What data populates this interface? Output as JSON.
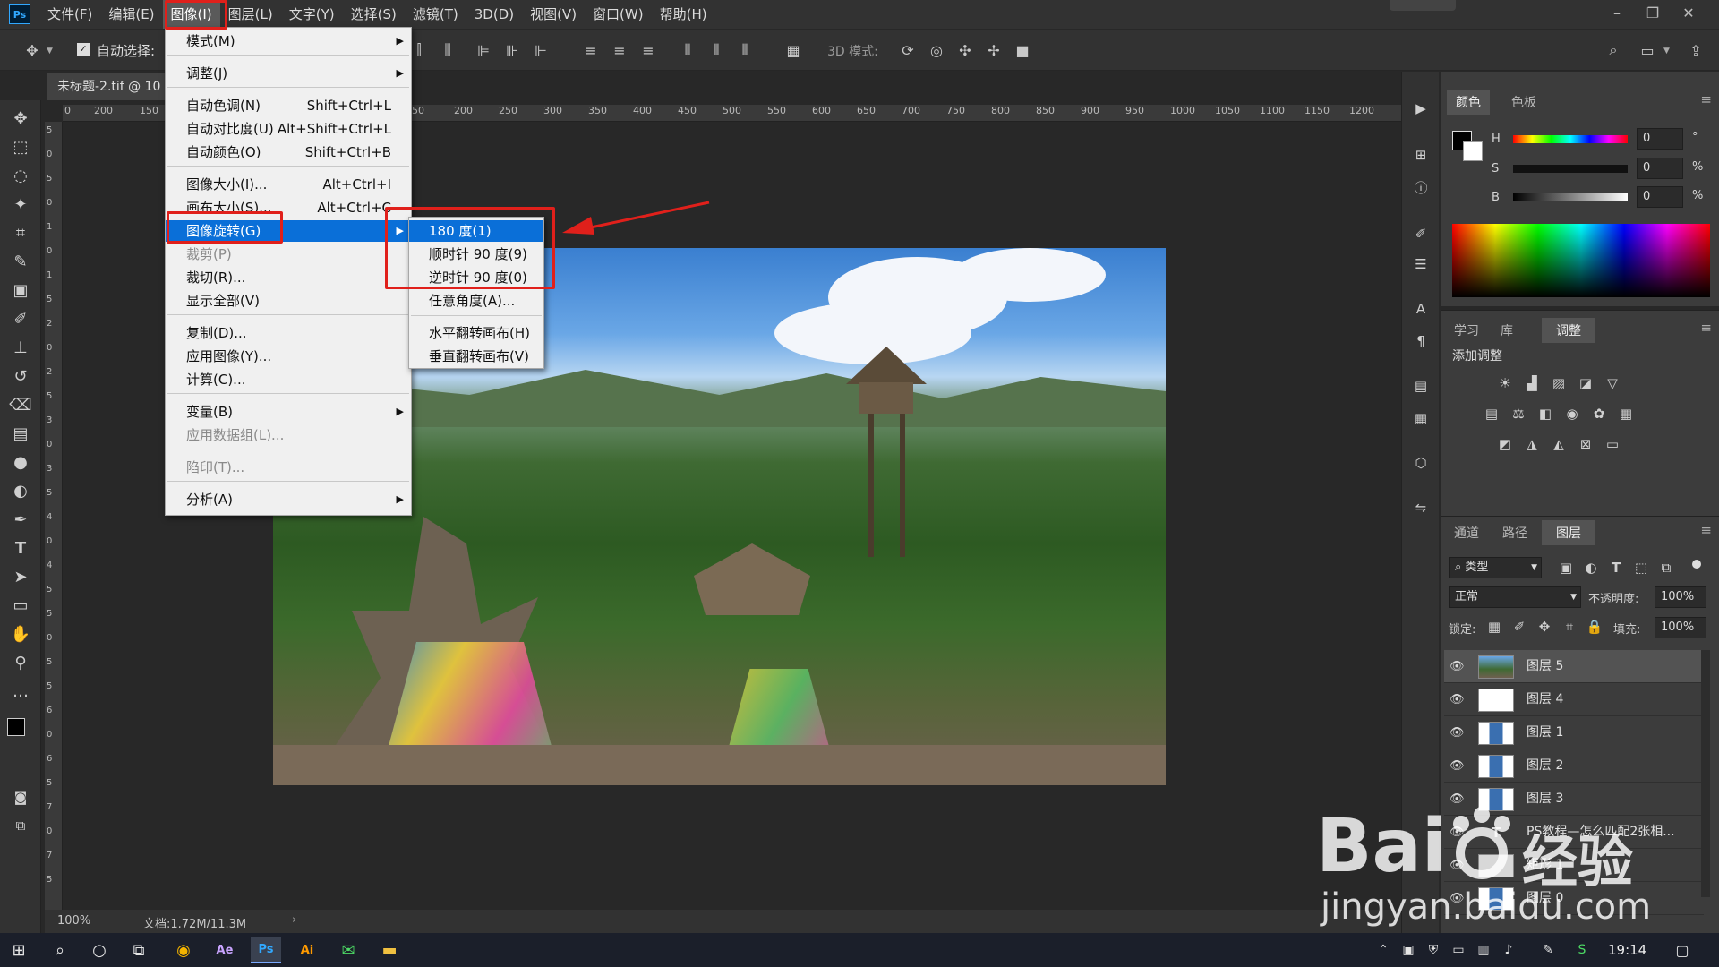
{
  "app": {
    "logo": "Ps"
  },
  "menubar": {
    "items": [
      "文件(F)",
      "编辑(E)",
      "图像(I)",
      "图层(L)",
      "文字(Y)",
      "选择(S)",
      "滤镜(T)",
      "3D(D)",
      "视图(V)",
      "窗口(W)",
      "帮助(H)"
    ],
    "active_index": 2
  },
  "optionsbar": {
    "auto_select_label": "自动选择:",
    "mode_3d_label": "3D 模式:"
  },
  "document": {
    "tab_title": "未标题-2.tif @ 10",
    "zoom": "100%",
    "doc_info": "文档:1.72M/11.3M"
  },
  "ruler": {
    "h_ticks": [
      "0",
      "200",
      "150",
      "50",
      "200",
      "250",
      "300",
      "350",
      "400",
      "450",
      "500",
      "550",
      "600",
      "650",
      "700",
      "750",
      "800",
      "850",
      "900",
      "950",
      "1000",
      "1050",
      "1100",
      "1150",
      "1200"
    ],
    "v_ticks": [
      "5",
      "0",
      "5",
      "0",
      "1",
      "0",
      "1",
      "5",
      "2",
      "0",
      "2",
      "5",
      "3",
      "0",
      "3",
      "5",
      "4",
      "0",
      "4",
      "5",
      "5",
      "0",
      "5",
      "5",
      "6",
      "0",
      "6",
      "5",
      "7",
      "0",
      "7",
      "5"
    ]
  },
  "image_menu": [
    {
      "label": "模式(M)",
      "shortcut": "",
      "submenu": true,
      "disabled": false
    },
    {
      "sep": true
    },
    {
      "label": "调整(J)",
      "shortcut": "",
      "submenu": true,
      "disabled": false
    },
    {
      "sep": true
    },
    {
      "label": "自动色调(N)",
      "shortcut": "Shift+Ctrl+L",
      "submenu": false,
      "disabled": false
    },
    {
      "label": "自动对比度(U)",
      "shortcut": "Alt+Shift+Ctrl+L",
      "submenu": false,
      "disabled": false
    },
    {
      "label": "自动颜色(O)",
      "shortcut": "Shift+Ctrl+B",
      "submenu": false,
      "disabled": false
    },
    {
      "sep": true
    },
    {
      "label": "图像大小(I)...",
      "shortcut": "Alt+Ctrl+I",
      "submenu": false,
      "disabled": false
    },
    {
      "label": "画布大小(S)...",
      "shortcut": "Alt+Ctrl+C",
      "submenu": false,
      "disabled": false
    },
    {
      "label": "图像旋转(G)",
      "shortcut": "",
      "submenu": true,
      "disabled": false,
      "highlight": true
    },
    {
      "label": "裁剪(P)",
      "shortcut": "",
      "submenu": false,
      "disabled": true
    },
    {
      "label": "裁切(R)...",
      "shortcut": "",
      "submenu": false,
      "disabled": false
    },
    {
      "label": "显示全部(V)",
      "shortcut": "",
      "submenu": false,
      "disabled": false
    },
    {
      "sep": true
    },
    {
      "label": "复制(D)...",
      "shortcut": "",
      "submenu": false,
      "disabled": false
    },
    {
      "label": "应用图像(Y)...",
      "shortcut": "",
      "submenu": false,
      "disabled": false
    },
    {
      "label": "计算(C)...",
      "shortcut": "",
      "submenu": false,
      "disabled": false
    },
    {
      "sep": true
    },
    {
      "label": "变量(B)",
      "shortcut": "",
      "submenu": true,
      "disabled": false
    },
    {
      "label": "应用数据组(L)...",
      "shortcut": "",
      "submenu": false,
      "disabled": true
    },
    {
      "sep": true
    },
    {
      "label": "陷印(T)...",
      "shortcut": "",
      "submenu": false,
      "disabled": true
    },
    {
      "sep": true
    },
    {
      "label": "分析(A)",
      "shortcut": "",
      "submenu": true,
      "disabled": false
    }
  ],
  "rotation_submenu": [
    {
      "label": "180 度(1)",
      "highlight": true
    },
    {
      "label": "顺时针 90 度(9)"
    },
    {
      "label": "逆时针 90 度(0)"
    },
    {
      "label": "任意角度(A)..."
    },
    {
      "sep": true
    },
    {
      "label": "水平翻转画布(H)"
    },
    {
      "label": "垂直翻转画布(V)"
    }
  ],
  "annotation": {
    "color": "#e0201b"
  },
  "color_panel": {
    "tabs": [
      "颜色",
      "色板"
    ],
    "active": 0,
    "h_label": "H",
    "s_label": "S",
    "b_label": "B",
    "h_value": "0",
    "s_value": "0",
    "b_value": "0",
    "h_unit": "°",
    "s_unit": "%",
    "b_unit": "%"
  },
  "adjust_panel": {
    "tabs": [
      "学习",
      "库",
      "调整"
    ],
    "active": 2,
    "title": "添加调整"
  },
  "layers_panel": {
    "tabs": [
      "通道",
      "路径",
      "图层"
    ],
    "active": 2,
    "filter_label": "类型",
    "blend_mode": "正常",
    "opacity_label": "不透明度:",
    "opacity_value": "100%",
    "lock_label": "锁定:",
    "fill_label": "填充:",
    "fill_value": "100%",
    "layers": [
      {
        "name": "图层 5",
        "thumb": "photo",
        "selected": true
      },
      {
        "name": "图层 4",
        "thumb": "white",
        "selected": false
      },
      {
        "name": "图层 1",
        "thumb": "person",
        "selected": false
      },
      {
        "name": "图层 2",
        "thumb": "person",
        "selected": false
      },
      {
        "name": "图层 3",
        "thumb": "person",
        "selected": false
      },
      {
        "name": "PS教程—怎么匹配2张相...",
        "thumb": "text",
        "selected": false
      },
      {
        "name": "矩形 1",
        "thumb": "shape",
        "selected": false
      },
      {
        "name": "图层 0",
        "thumb": "person",
        "selected": false
      }
    ]
  },
  "taskbar": {
    "time": "19:14"
  },
  "watermark": {
    "brand": "Bai",
    "brand2": "经验",
    "url": "jingyan.baidu.com"
  }
}
